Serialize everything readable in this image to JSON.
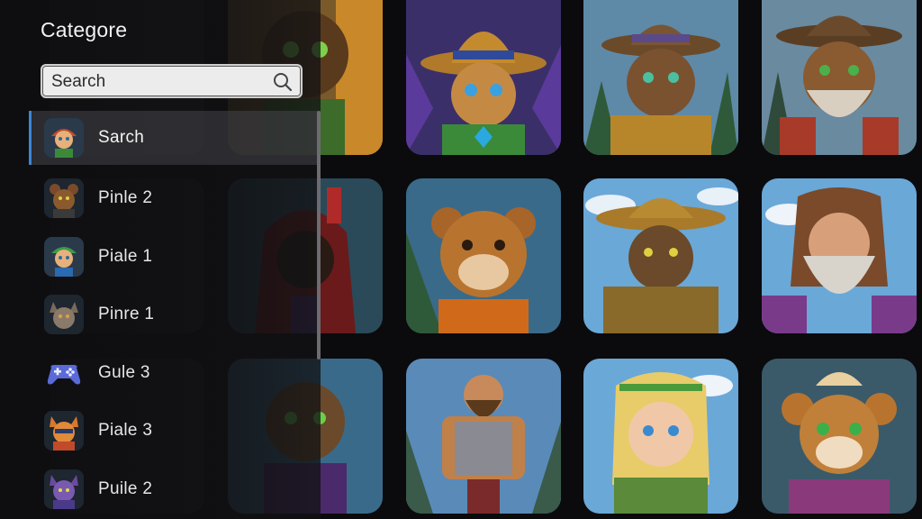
{
  "panel": {
    "title": "Categore",
    "search": {
      "placeholder": "Search",
      "value": ""
    },
    "items": [
      {
        "label": "Sarch",
        "icon": "elf-avatar-icon",
        "selected": true
      },
      {
        "label": "Pinle 2",
        "icon": "bear-avatar-icon",
        "selected": false
      },
      {
        "label": "Piale 1",
        "icon": "elf-avatar-icon",
        "selected": false
      },
      {
        "label": "Pinre 1",
        "icon": "wolf-avatar-icon",
        "selected": false
      },
      {
        "label": "Gule 3",
        "icon": "gamepad-icon",
        "selected": false
      },
      {
        "label": "Piale 3",
        "icon": "fox-avatar-icon",
        "selected": false
      },
      {
        "label": "Puile 2",
        "icon": "cat-avatar-icon",
        "selected": false
      }
    ]
  },
  "colors": {
    "accent": "#3a86d6",
    "background": "#0b0b0d"
  },
  "grid": {
    "tiles": [
      {
        "name": "bear-green-eyes-tile",
        "row": 0,
        "col": 1
      },
      {
        "name": "bear-blue-hat-tile",
        "row": 0,
        "col": 2
      },
      {
        "name": "bear-cowboy-armor-tile",
        "row": 0,
        "col": 3
      },
      {
        "name": "bear-bearded-hat-tile",
        "row": 0,
        "col": 4
      },
      {
        "name": "hooded-rogue-tile",
        "row": 1,
        "col": 1
      },
      {
        "name": "smiling-bear-tile",
        "row": 1,
        "col": 2
      },
      {
        "name": "armored-cowboy-bear-tile",
        "row": 1,
        "col": 3
      },
      {
        "name": "bearded-dwarf-tile",
        "row": 1,
        "col": 4
      },
      {
        "name": "bear-green-eyes-lower-tile",
        "row": 2,
        "col": 1
      },
      {
        "name": "barbarian-warrior-tile",
        "row": 2,
        "col": 2
      },
      {
        "name": "blonde-elf-girl-tile",
        "row": 2,
        "col": 3
      },
      {
        "name": "blond-bear-tile",
        "row": 2,
        "col": 4
      }
    ]
  }
}
